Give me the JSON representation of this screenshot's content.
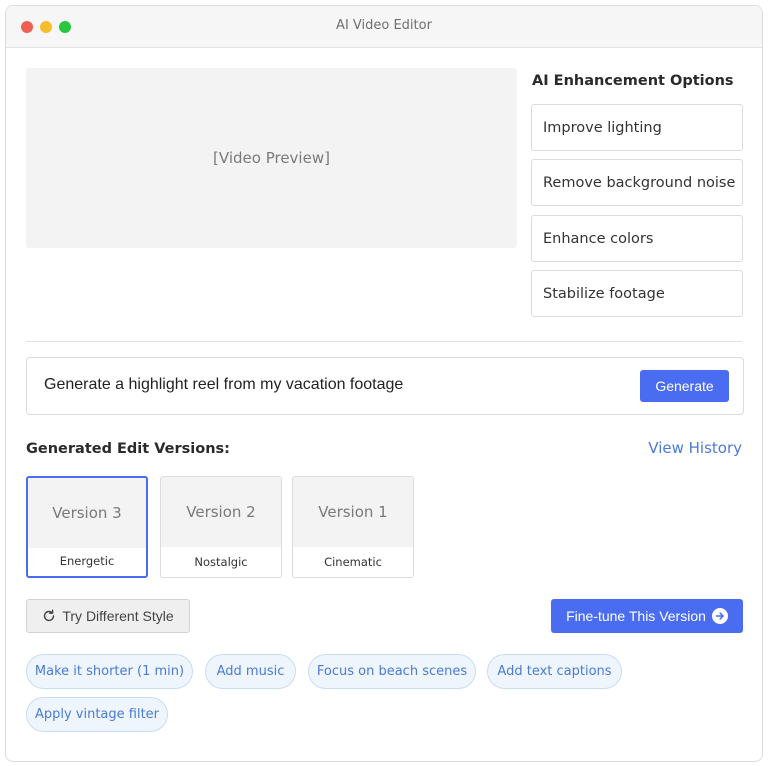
{
  "window": {
    "title": "AI Video Editor"
  },
  "video": {
    "placeholder": "[Video Preview]"
  },
  "ai_options": {
    "heading": "AI Enhancement Options",
    "items": [
      {
        "label": "Improve lighting"
      },
      {
        "label": "Remove background noise"
      },
      {
        "label": "Enhance colors"
      },
      {
        "label": "Stabilize footage"
      }
    ]
  },
  "prompt": {
    "text": "Generate a highlight reel from my vacation footage",
    "button_label": "Generate"
  },
  "versions": {
    "heading": "Generated Edit Versions:",
    "history_link": "View History",
    "items": [
      {
        "title": "Version 3",
        "label": "Energetic",
        "selected": true
      },
      {
        "title": "Version 2",
        "label": "Nostalgic",
        "selected": false
      },
      {
        "title": "Version 1",
        "label": "Cinematic",
        "selected": false
      }
    ]
  },
  "actions": {
    "try_label": "Try Different Style",
    "finetune_label": "Fine-tune This Version"
  },
  "suggestions": [
    {
      "label": "Make it shorter (1 min)"
    },
    {
      "label": "Add music"
    },
    {
      "label": "Focus on beach scenes"
    },
    {
      "label": "Add text captions"
    },
    {
      "label": "Apply vintage filter"
    }
  ],
  "icons": {
    "try": "refresh-icon",
    "finetune": "arrow-right-circle-icon"
  },
  "colors": {
    "accent": "#4a6cf0",
    "link": "#4a7bd6",
    "chip_bg": "#eef5fc"
  }
}
